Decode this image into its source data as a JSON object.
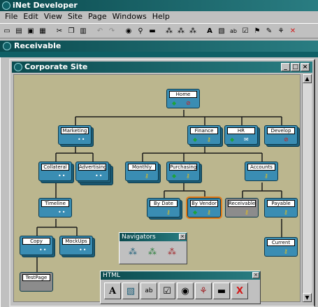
{
  "app": {
    "title": "iNet Developer",
    "menus": [
      "File",
      "Edit",
      "View",
      "Site",
      "Page",
      "Windows",
      "Help"
    ],
    "toolbar_icons": [
      "new-icon",
      "open-icon",
      "save-icon",
      "print-icon",
      "cut-icon",
      "copy-icon",
      "paste-icon",
      "undo-icon",
      "redo-icon",
      "preview-icon",
      "find-icon",
      "publish-icon",
      "tree-icon",
      "tree-alt-icon",
      "tree-wide-icon",
      "text-icon",
      "font-icon",
      "abc-icon",
      "checkbox-icon",
      "link-icon",
      "form-icon",
      "image-icon",
      "html-icon"
    ]
  },
  "receivable_window": {
    "title": "Receivable"
  },
  "site_window": {
    "title": "Corporate Site",
    "buttons": {
      "minimize": "_",
      "maximize": "□",
      "close": "×"
    }
  },
  "nodes": {
    "home": "Home",
    "marketing": "Marketing",
    "finance": "Finance",
    "hr": "HR",
    "develop": "Develop",
    "collateral": "Collateral",
    "advertising": "Advertising",
    "monthly": "Monthly",
    "purchasing": "Purchasing",
    "accounts": "Accounts",
    "timeline": "Timeline",
    "by_date": "By Date",
    "by_vendor": "By Vendor",
    "receivable": "Receivable",
    "payable": "Payable",
    "copy": "Copy",
    "mockups": "MockUps",
    "current": "Current",
    "testpage": "TestPage"
  },
  "navigators_palette": {
    "title": "Navigators",
    "close": "×"
  },
  "html_palette": {
    "title": "HTML",
    "close": "×",
    "text_glyph": "A",
    "abc": "ab",
    "form_x": "X"
  }
}
